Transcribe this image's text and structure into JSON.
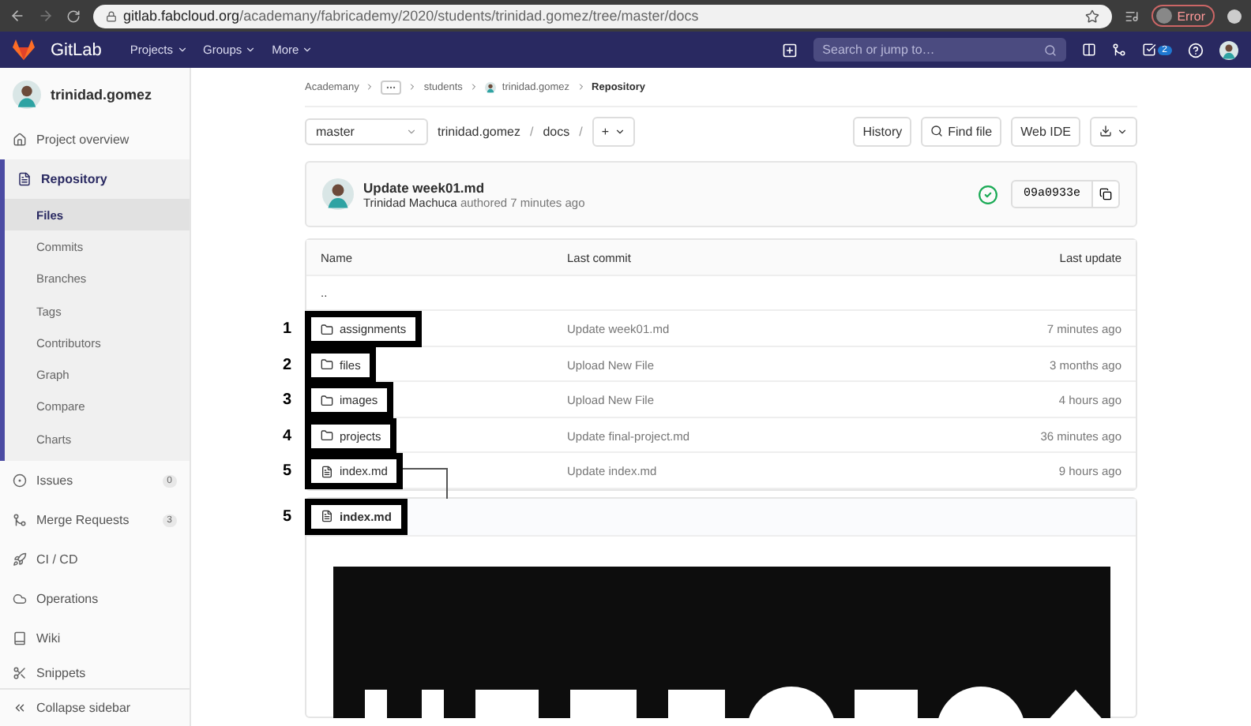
{
  "browser": {
    "url_host": "gitlab.fabcloud.org",
    "url_path": "/academany/fabricademy/2020/students/trinidad.gomez/tree/master/docs",
    "profile_label": "Error"
  },
  "navbar": {
    "brand": "GitLab",
    "menus": [
      "Projects",
      "Groups",
      "More"
    ],
    "search": {
      "placeholder": "Search or jump to…"
    },
    "todo_count": "2"
  },
  "sidebar": {
    "project": "trinidad.gomez",
    "items": [
      {
        "label": "Project overview",
        "selected": false
      },
      {
        "label": "Repository",
        "selected": true,
        "children": [
          {
            "label": "Files",
            "selected": true
          },
          {
            "label": "Commits",
            "selected": false
          },
          {
            "label": "Branches",
            "selected": false
          },
          {
            "label": "Tags",
            "selected": false
          },
          {
            "label": "Contributors",
            "selected": false
          },
          {
            "label": "Graph",
            "selected": false
          },
          {
            "label": "Compare",
            "selected": false
          },
          {
            "label": "Charts",
            "selected": false
          }
        ]
      },
      {
        "label": "Issues",
        "selected": false,
        "badge": "0"
      },
      {
        "label": "Merge Requests",
        "selected": false,
        "badge": "3"
      },
      {
        "label": "CI / CD",
        "selected": false
      },
      {
        "label": "Operations",
        "selected": false
      },
      {
        "label": "Wiki",
        "selected": false
      },
      {
        "label": "Snippets",
        "selected": false
      }
    ],
    "collapse": "Collapse sidebar"
  },
  "breadcrumbs": [
    {
      "kind": "link",
      "label": "Academany"
    },
    {
      "kind": "more"
    },
    {
      "kind": "link",
      "label": "students"
    },
    {
      "kind": "avatar",
      "label": "trinidad.gomez"
    },
    {
      "kind": "current",
      "label": "Repository"
    }
  ],
  "toolbar": {
    "branch": "master",
    "path": [
      "trinidad.gomez",
      "docs"
    ],
    "separator": "/",
    "add": "+",
    "buttons": [
      {
        "kind": "text",
        "label": "History"
      },
      {
        "kind": "search",
        "label": "Find file"
      },
      {
        "kind": "text",
        "label": "Web IDE"
      },
      {
        "kind": "download"
      }
    ]
  },
  "commit": {
    "title": "Update week01.md",
    "author": "Trinidad Machuca",
    "action": "authored 7 minutes ago",
    "pipeline_passed": true,
    "sha": "09a0933e"
  },
  "table": {
    "columns": [
      "Name",
      "Last commit",
      "Last update"
    ],
    "parent": "..",
    "rows": [
      {
        "kind": "folder",
        "name": "assignments",
        "commit": "Update week01.md",
        "updated": "7 minutes ago",
        "marker": "1"
      },
      {
        "kind": "folder",
        "name": "files",
        "commit": "Upload New File",
        "updated": "3 months ago",
        "marker": "2"
      },
      {
        "kind": "folder",
        "name": "images",
        "commit": "Upload New File",
        "updated": "4 hours ago",
        "marker": "3"
      },
      {
        "kind": "folder",
        "name": "projects",
        "commit": "Update final-project.md",
        "updated": "36 minutes ago",
        "marker": "4"
      },
      {
        "kind": "file",
        "name": "index.md",
        "commit": "Update index.md",
        "updated": "9 hours ago",
        "marker": "5"
      }
    ]
  },
  "readme": {
    "filename": "index.md",
    "marker": "5",
    "arrow_from_row": true
  }
}
